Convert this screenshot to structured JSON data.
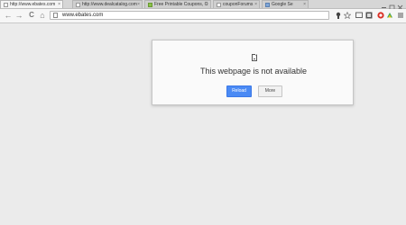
{
  "browser": {
    "tabs": [
      {
        "label": "http://www.ebates.com",
        "close": "×",
        "favicon": "page-icon"
      },
      {
        "label": "http://www.dealcatalog.com",
        "close": "×",
        "favicon": "page-icon"
      },
      {
        "label": "Free Printable Coupons, C",
        "close": "×",
        "favicon": "green"
      },
      {
        "label": "couponForums",
        "close": "×",
        "favicon": "page-icon"
      },
      {
        "label": "Google Se",
        "close": "×",
        "favicon": "blue"
      }
    ],
    "address": {
      "url": "www.ebates.com"
    },
    "nav": {
      "back": "←",
      "forward": "→",
      "reload": "C",
      "home": "⌂"
    }
  },
  "error": {
    "title": "This webpage is not available",
    "reload_label": "Reload",
    "more_label": "More"
  },
  "colors": {
    "primary_button": "#4a8af4",
    "page_background": "#ebebeb"
  }
}
